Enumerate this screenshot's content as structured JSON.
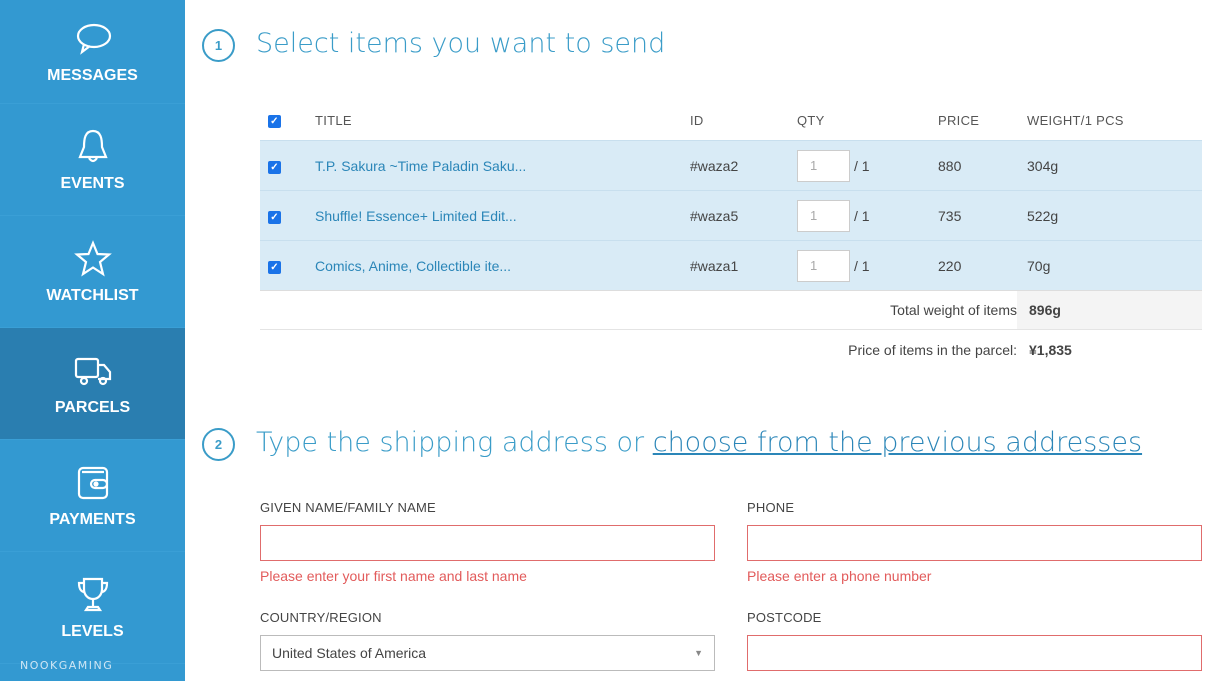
{
  "sidebar": {
    "items": [
      {
        "label": "MESSAGES",
        "icon": "speech-bubble-icon"
      },
      {
        "label": "EVENTS",
        "icon": "bell-icon"
      },
      {
        "label": "WATCHLIST",
        "icon": "star-icon"
      },
      {
        "label": "PARCELS",
        "icon": "truck-icon",
        "active": true
      },
      {
        "label": "PAYMENTS",
        "icon": "wallet-icon"
      },
      {
        "label": "LEVELS",
        "icon": "trophy-icon"
      }
    ],
    "brand": "NOOKGAMING"
  },
  "section1": {
    "step": "1",
    "heading": "Select items you want to send",
    "columns": [
      "TITLE",
      "ID",
      "QTY",
      "PRICE",
      "WEIGHT/1 PCS"
    ],
    "items": [
      {
        "title": "T.P. Sakura ~Time Paladin Saku...",
        "id": "#waza2",
        "qty": "1",
        "max": "/ 1",
        "price": "880",
        "weight": "304g"
      },
      {
        "title": "Shuffle! Essence+ Limited Edit...",
        "id": "#waza5",
        "qty": "1",
        "max": "/ 1",
        "price": "735",
        "weight": "522g"
      },
      {
        "title": "Comics, Anime, Collectible ite...",
        "id": "#waza1",
        "qty": "1",
        "max": "/ 1",
        "price": "220",
        "weight": "70g"
      }
    ],
    "total_weight_label": "Total weight of items",
    "total_weight": "896g",
    "price_label": "Price of items in the parcel:",
    "price": "¥1,835"
  },
  "section2": {
    "step": "2",
    "heading_prefix": "Type the shipping address or ",
    "heading_link": "choose from the previous addresses",
    "name_label": "GIVEN NAME/FAMILY NAME",
    "name_error": "Please enter your first name and last name",
    "phone_label": "PHONE",
    "phone_error": "Please enter a phone number",
    "country_label": "COUNTRY/REGION",
    "country_value": "United States of America",
    "postcode_label": "POSTCODE"
  }
}
